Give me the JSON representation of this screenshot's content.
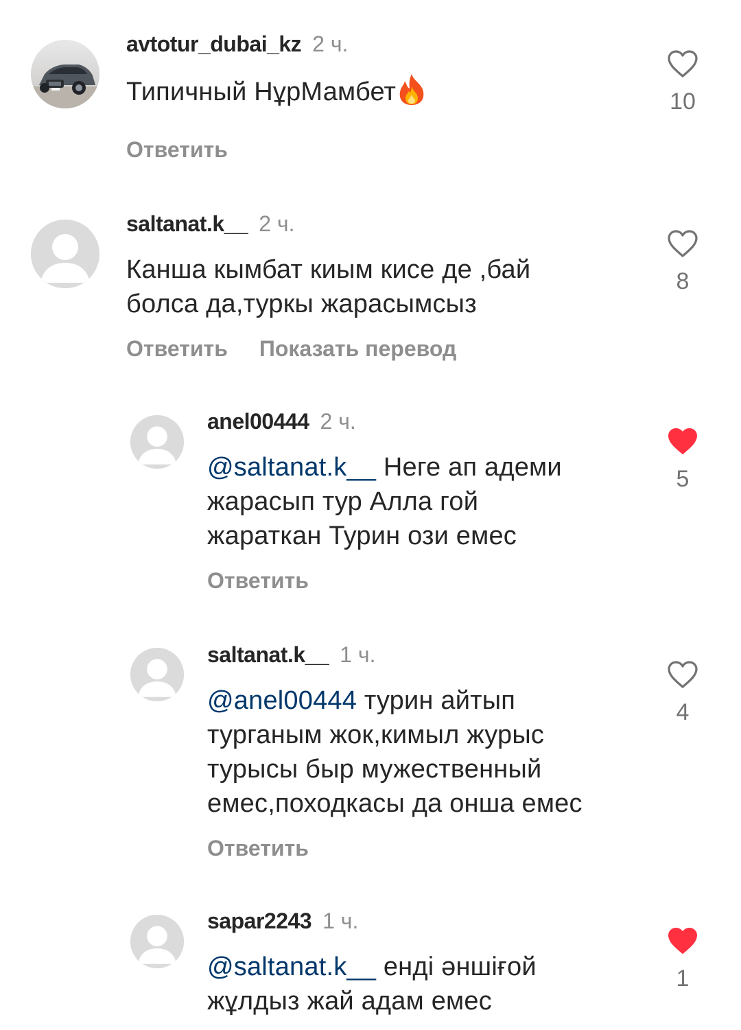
{
  "comments": [
    {
      "username": "avtotur_dubai_kz",
      "time": "2 ч.",
      "text": "Типичный НұрМамбет",
      "emoji_icon": "fire-emoji-icon",
      "like_count": "10",
      "liked": false,
      "reply_label": "Ответить"
    },
    {
      "username": "saltanat.k__",
      "time": "2 ч.",
      "text_line1": "Канша кымбат киым кисе де ,бай",
      "text_line2": "болса да,туркы жарасымсыз",
      "like_count": "8",
      "liked": false,
      "reply_label": "Ответить",
      "translate_label": "Показать перевод"
    },
    {
      "username": "anel00444",
      "time": "2 ч.",
      "mention": "@saltanat.k__",
      "text_line1": " Неге ап адеми",
      "text_line2": "жарасып тур Алла гой",
      "text_line3": "жараткан Турин ози емес",
      "like_count": "5",
      "liked": true,
      "reply_label": "Ответить"
    },
    {
      "username": "saltanat.k__",
      "time": "1 ч.",
      "mention": "@anel00444",
      "text_line1": " турин айтып",
      "text_line2": "турганым жок,кимыл журыс",
      "text_line3": "турысы быр мужественный",
      "text_line4": "емес,походкасы да онша емес",
      "like_count": "4",
      "liked": false,
      "reply_label": "Ответить"
    },
    {
      "username": "sapar2243",
      "time": "1 ч.",
      "mention": "@saltanat.k__",
      "text_line1": " енді әншіғой",
      "text_line2": "жұлдыз жай адам емес",
      "like_count": "1",
      "liked": true
    }
  ],
  "colors": {
    "text": "#262626",
    "secondary": "#8e8e8e",
    "mention": "#00376b",
    "like_red": "#ff3040"
  }
}
